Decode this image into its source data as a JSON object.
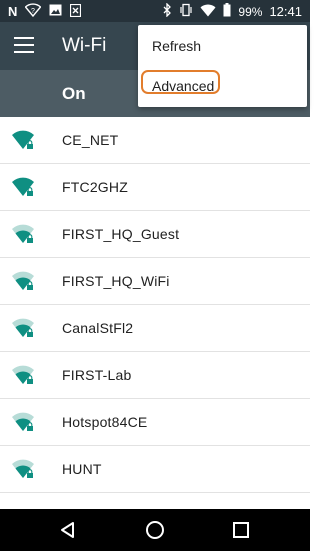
{
  "status_bar": {
    "left_icons": [
      "n-notification-icon",
      "wifi-question-icon",
      "image-notification-icon",
      "screenshot-notification-icon"
    ],
    "right_icons": [
      "bluetooth-icon",
      "vibrate-icon",
      "wifi-signal-icon",
      "battery-icon"
    ],
    "battery_percent": "99%",
    "time": "12:41"
  },
  "app_bar": {
    "title": "Wi-Fi",
    "menu_icon": "hamburger-menu-icon"
  },
  "wifi_toggle": {
    "label": "On",
    "state": true
  },
  "overflow_menu": {
    "items": [
      {
        "label": "Refresh"
      },
      {
        "label": "Advanced",
        "highlighted": true
      }
    ],
    "highlight_color": "#e27d2c"
  },
  "networks": [
    {
      "name": "CE_NET",
      "signal": "full",
      "locked": true
    },
    {
      "name": "FTC2GHZ",
      "signal": "full",
      "locked": true
    },
    {
      "name": "FIRST_HQ_Guest",
      "signal": "medium",
      "locked": true
    },
    {
      "name": "FIRST_HQ_WiFi",
      "signal": "medium",
      "locked": true
    },
    {
      "name": "CanalStFl2",
      "signal": "medium",
      "locked": true
    },
    {
      "name": "FIRST-Lab",
      "signal": "medium",
      "locked": true
    },
    {
      "name": "Hotspot84CE",
      "signal": "medium",
      "locked": true
    },
    {
      "name": "HUNT",
      "signal": "medium",
      "locked": true
    }
  ],
  "nav_bar": {
    "buttons": [
      "back-icon",
      "home-icon",
      "recents-icon"
    ]
  },
  "colors": {
    "status_bar": "#26323a",
    "app_bar": "#36464f",
    "on_bar": "#4d5c64",
    "wifi_icon": "#0f8f82",
    "nav_bar": "#000000"
  }
}
